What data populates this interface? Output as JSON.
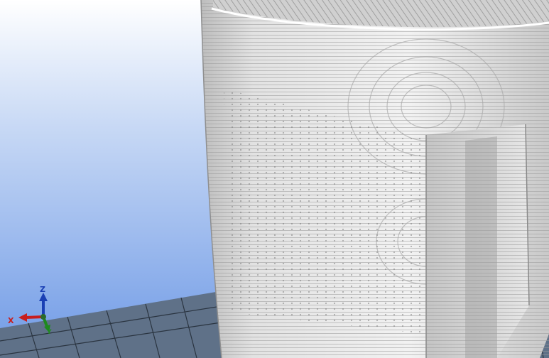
{
  "viewport": {
    "background_top": "#ffffff",
    "background_bottom": "#6f9ae6",
    "floor_color": "#5f7188",
    "floor_grid_color": "#2a3440"
  },
  "model": {
    "surface_color": "#d9d9d9",
    "surface_light": "#f4f4f4",
    "layer_line_color": "#9a9a9a"
  },
  "axis_triad": {
    "x_label": "X",
    "y_label": "Y",
    "z_label": "Z",
    "x_color": "#c81e1e",
    "y_color": "#1e8a1e",
    "z_color": "#1a3fb4"
  }
}
